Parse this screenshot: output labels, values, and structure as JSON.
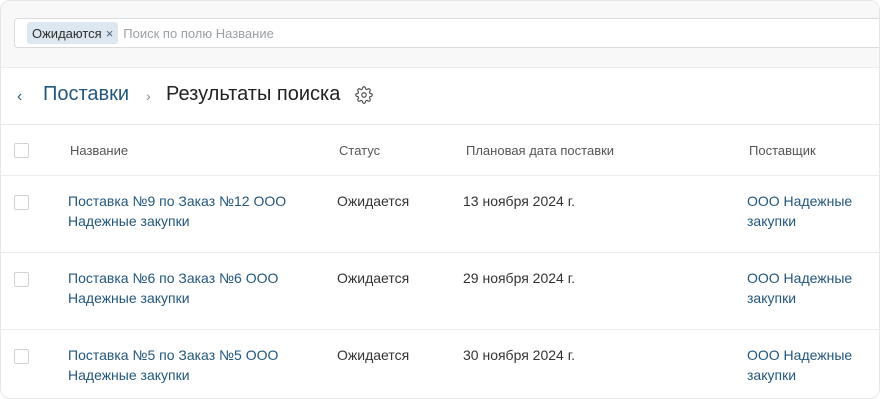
{
  "filter": {
    "chip_label": "Ожидаются",
    "chip_close": "×",
    "search_placeholder": "Поиск по полю Название"
  },
  "breadcrumb": {
    "back": "‹",
    "root": "Поставки",
    "separator": "›",
    "current": "Результаты поиска"
  },
  "table": {
    "columns": [
      "Название",
      "Статус",
      "Плановая дата поставки",
      "Поставщик"
    ],
    "rows": [
      {
        "name": "Поставка №9 по Заказ №12 ООО Надежные закупки",
        "status": "Ожидается",
        "date": "13 ноября 2024 г.",
        "supplier": "ООО Надежные закупки"
      },
      {
        "name": "Поставка №6 по Заказ №6 ООО Надежные закупки",
        "status": "Ожидается",
        "date": "29 ноября 2024 г.",
        "supplier": "ООО Надежные закупки"
      },
      {
        "name": "Поставка №5 по Заказ №5 ООО Надежные закупки",
        "status": "Ожидается",
        "date": "30 ноября 2024 г.",
        "supplier": "ООО Надежные закупки"
      }
    ]
  },
  "colors": {
    "link": "#22577e",
    "chip_bg": "#dde7ef",
    "border": "#ececec"
  },
  "icons": {
    "settings": "gear-icon",
    "back": "chevron-left-icon",
    "separator": "chevron-right-icon",
    "chip_remove": "close-icon"
  }
}
